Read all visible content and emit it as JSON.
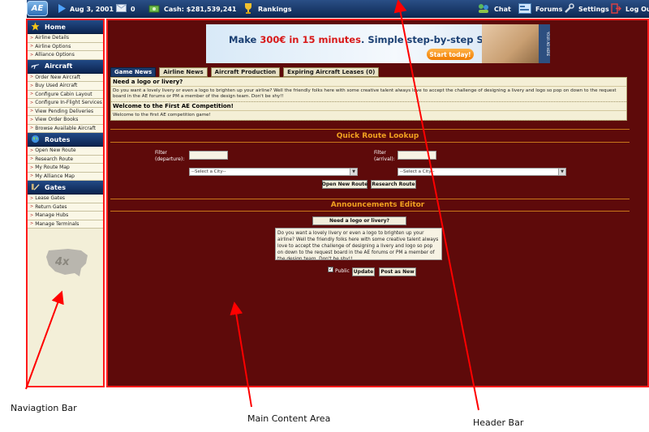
{
  "header": {
    "logo_text": "AE",
    "date": "Aug 3, 2001",
    "messages_count": "0",
    "cash": "Cash: $281,539,241",
    "rankings": "Rankings",
    "chat": "Chat",
    "forums": "Forums",
    "settings": "Settings",
    "logout": "Log Out"
  },
  "nav": {
    "sections": [
      {
        "title": "Home",
        "icon": "star-icon",
        "items": [
          "Airline Details",
          "Airline Options",
          "Alliance Options"
        ]
      },
      {
        "title": "Aircraft",
        "icon": "plane-icon",
        "items": [
          "Order New Aircraft",
          "Buy Used Aircraft",
          "Configure Cabin Layout",
          "Configure In-Flight Services",
          "View Pending Deliveries",
          "View Order Books",
          "Browse Available Aircraft"
        ]
      },
      {
        "title": "Routes",
        "icon": "globe-icon",
        "items": [
          "Open New Route",
          "Research Route",
          "My Route Map",
          "My Alliance Map"
        ]
      },
      {
        "title": "Gates",
        "icon": "gate-icon",
        "items": [
          "Lease Gates",
          "Return Gates",
          "Manage Hubs",
          "Manage Terminals"
        ]
      }
    ],
    "badge_text": "4x"
  },
  "ad": {
    "text_a": "Make ",
    "text_b": "300€ in 15 minutes",
    "text_c": ". Simple step-by-step System.",
    "button": "Start today!",
    "side": "YOUR AD HERE"
  },
  "tabs": [
    "Game News",
    "Airline News",
    "Aircraft Production",
    "Expiring Aircraft Leases (0)"
  ],
  "news": [
    {
      "title": "Need a logo or livery?",
      "body": "Do you want a lovely livery or even a logo to brighten up your airline? Well the friendly folks here with some creative talent always love to accept the challenge of designing a livery and logo so pop on down to the request board in the AE forums or PM a member of the design team. Don't be shy!!"
    },
    {
      "title": "Welcome to the First AE Competition!",
      "body": "Welcome to the first AE competition game!"
    }
  ],
  "quick_route": {
    "title": "Quick Route Lookup",
    "filter_dep": "Filter\n(departure):",
    "filter_arr": "Filter\n(arrival):",
    "select_placeholder": "--Select a City--",
    "open_btn": "Open New Route",
    "research_btn": "Research Route"
  },
  "announcements": {
    "title": "Announcements Editor",
    "headline": "Need a logo or livery?",
    "body": "Do you want a lovely livery or even a logo to brighten up your airline? Well the friendly folks here with some creative talent always love to accept the challenge of designing a livery and logo so pop on down to the request board in the AE forums or PM a member of the design team. Don't be shy!!",
    "public_label": "Public",
    "update_btn": "Update",
    "post_btn": "Post as New"
  },
  "annotations": {
    "nav": "Naviagtion Bar",
    "main": "Main Content Area",
    "header": "Header Bar",
    "color": "#ff0000"
  },
  "colors": {
    "header": "#1a3a6e",
    "nav_bg": "#f3efd8",
    "main_bg": "#5e0a0a",
    "section_title": "#f0a020",
    "highlight": "#ff1a1a"
  }
}
